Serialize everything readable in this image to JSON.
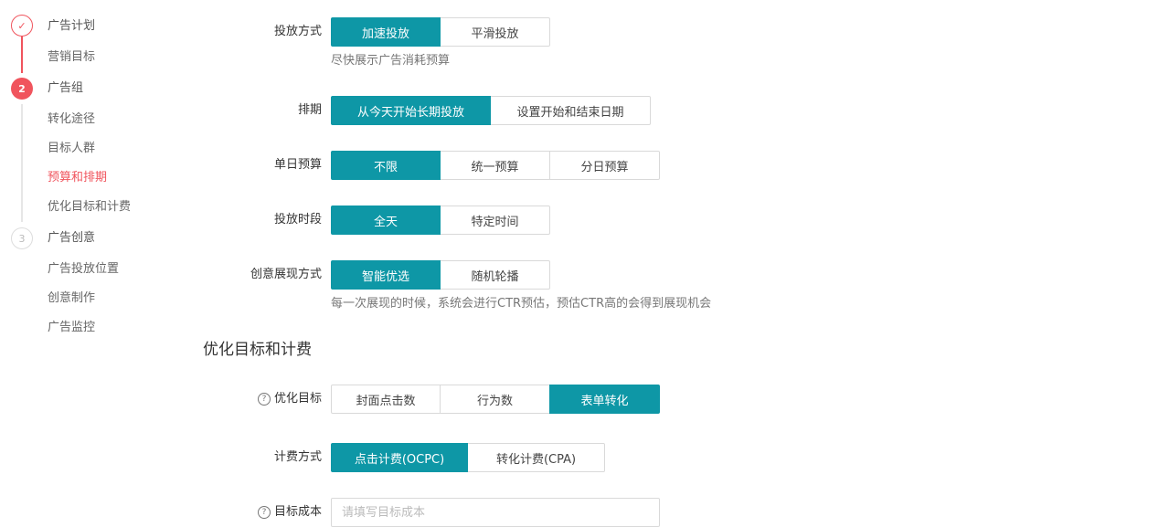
{
  "steps": {
    "step1": {
      "label": "广告计划",
      "subs": [
        "营销目标"
      ]
    },
    "step2": {
      "number": "2",
      "label": "广告组",
      "subs": [
        "转化途径",
        "目标人群",
        "预算和排期",
        "优化目标和计费"
      ]
    },
    "step3": {
      "number": "3",
      "label": "广告创意",
      "subs": [
        "广告投放位置",
        "创意制作",
        "广告监控"
      ]
    }
  },
  "form": {
    "delivery_mode": {
      "label": "投放方式",
      "options": [
        "加速投放",
        "平滑投放"
      ],
      "selected": 0,
      "hint": "尽快展示广告消耗预算"
    },
    "schedule": {
      "label": "排期",
      "options": [
        "从今天开始长期投放",
        "设置开始和结束日期"
      ],
      "selected": 0
    },
    "daily_budget": {
      "label": "单日预算",
      "options": [
        "不限",
        "统一预算",
        "分日预算"
      ],
      "selected": 0
    },
    "time_slot": {
      "label": "投放时段",
      "options": [
        "全天",
        "特定时间"
      ],
      "selected": 0
    },
    "creative_display": {
      "label": "创意展现方式",
      "options": [
        "智能优选",
        "随机轮播"
      ],
      "selected": 0,
      "hint": "每一次展现的时候，系统会进行CTR预估，预估CTR高的会得到展现机会"
    }
  },
  "section_title": "优化目标和计费",
  "optimization": {
    "goal": {
      "label": "优化目标",
      "options": [
        "封面点击数",
        "行为数",
        "表单转化"
      ],
      "selected": 2
    },
    "billing": {
      "label": "计费方式",
      "options": [
        "点击计费(OCPC)",
        "转化计费(CPA)"
      ],
      "selected": 0
    },
    "target_cost": {
      "label": "目标成本",
      "placeholder": "请填写目标成本"
    }
  },
  "icons": {
    "done": "check-icon",
    "help": "question-circle-icon",
    "help_glyph": "?",
    "check_glyph": "✓"
  },
  "colors": {
    "accent": "#0e97a6",
    "active_step": "#f0545d",
    "border": "#d9d9d9"
  }
}
